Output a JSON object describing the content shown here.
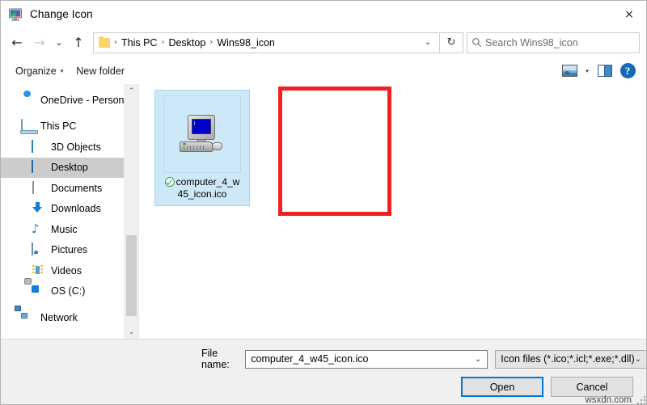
{
  "window": {
    "title": "Change Icon",
    "icon": "monitor-display-icon",
    "close_label": "×"
  },
  "nav": {
    "back": "←",
    "forward": "→",
    "recent": "⌄",
    "up": "↑",
    "refresh": "↻",
    "dropdown": "⌄",
    "breadcrumbs": [
      "This PC",
      "Desktop",
      "Wins98_icon"
    ],
    "separator": "›",
    "search_placeholder": "Search Wins98_icon",
    "search_icon": "⚲"
  },
  "toolbar": {
    "organize_label": "Organize",
    "organize_caret": "▾",
    "new_folder_label": "New folder",
    "view_caret": "▾",
    "help_label": "?"
  },
  "sidebar": {
    "items": [
      {
        "label": "OneDrive - Person",
        "icon": "onedrive-cloud-icon",
        "indent": false,
        "selected": false
      },
      {
        "label": "This PC",
        "icon": "this-pc-icon",
        "indent": false,
        "selected": false
      },
      {
        "label": "3D Objects",
        "icon": "3d-objects-icon",
        "indent": true,
        "selected": false
      },
      {
        "label": "Desktop",
        "icon": "desktop-icon",
        "indent": true,
        "selected": true
      },
      {
        "label": "Documents",
        "icon": "documents-icon",
        "indent": true,
        "selected": false
      },
      {
        "label": "Downloads",
        "icon": "downloads-icon",
        "indent": true,
        "selected": false
      },
      {
        "label": "Music",
        "icon": "music-note-icon",
        "indent": true,
        "selected": false
      },
      {
        "label": "Pictures",
        "icon": "pictures-icon",
        "indent": true,
        "selected": false
      },
      {
        "label": "Videos",
        "icon": "videos-icon",
        "indent": true,
        "selected": false
      },
      {
        "label": "OS (C:)",
        "icon": "os-drive-icon",
        "indent": true,
        "selected": false
      },
      {
        "label": "Network",
        "icon": "network-icon",
        "indent": false,
        "selected": false
      }
    ],
    "scroll_up": "⌃",
    "scroll_down": "⌄"
  },
  "files": [
    {
      "name_line1": "computer_4_w",
      "name_line2": "45_icon.ico",
      "full_name": "computer_4_w45_icon.ico",
      "icon": "windows98-computer-icon",
      "sync_status": "synced",
      "selected": true
    }
  ],
  "annotation": {
    "highlight_color": "#ee2222"
  },
  "footer": {
    "file_name_label": "File name:",
    "file_name_value": "computer_4_w45_icon.ico",
    "file_name_caret": "⌄",
    "filter_value": "Icon files (*.ico;*.icl;*.exe;*.dll)",
    "filter_caret": "⌄",
    "open_label": "Open",
    "cancel_label": "Cancel"
  },
  "watermark": "wsxdn.com"
}
